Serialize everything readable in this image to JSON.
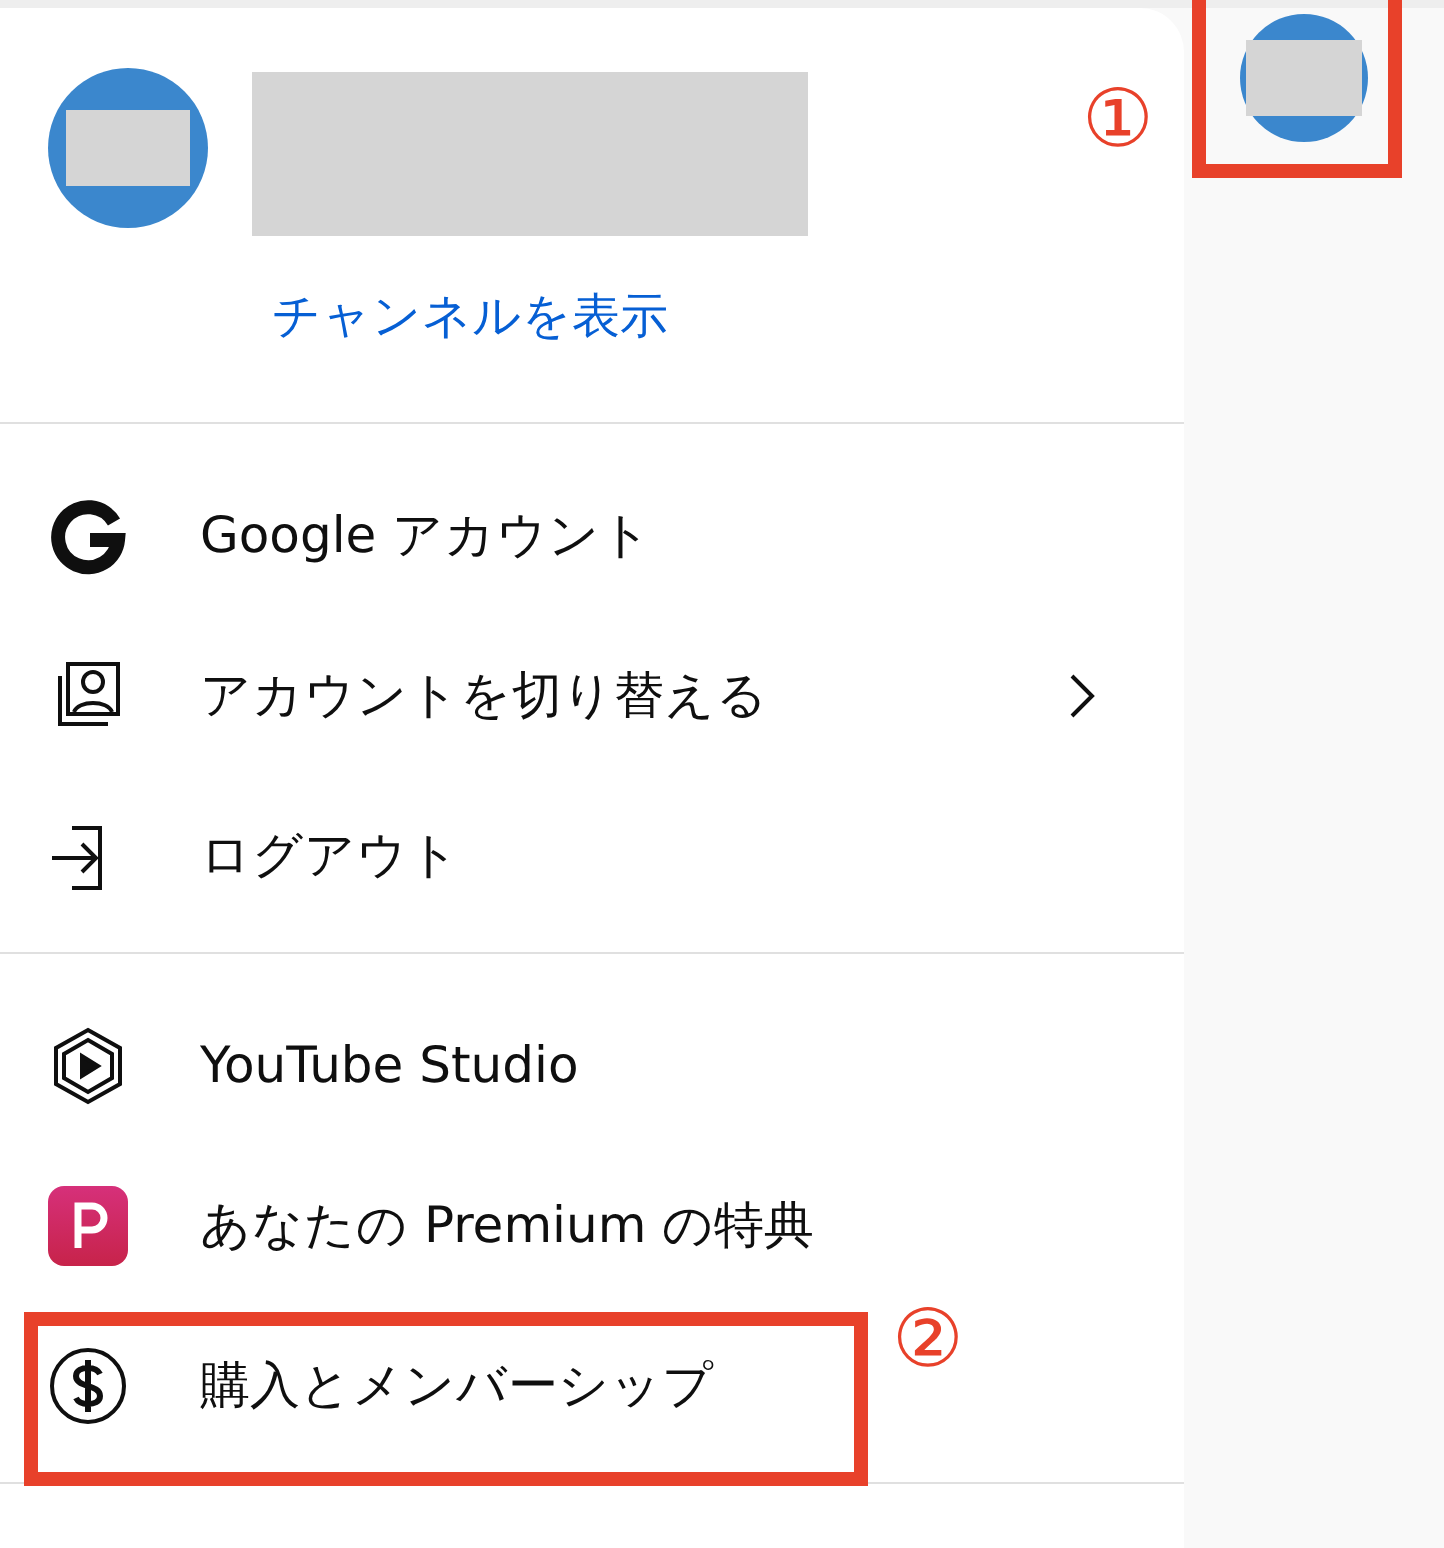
{
  "account_menu": {
    "channel_link": "チャンネルを表示",
    "sections": [
      {
        "items": [
          {
            "kind": "google",
            "label": "Google アカウント",
            "submenu": false
          },
          {
            "kind": "switch",
            "label": "アカウントを切り替える",
            "submenu": true
          },
          {
            "kind": "logout",
            "label": "ログアウト",
            "submenu": false
          }
        ]
      },
      {
        "items": [
          {
            "kind": "studio",
            "label": "YouTube Studio",
            "submenu": false
          },
          {
            "kind": "premium",
            "label": "あなたの Premium の特典",
            "submenu": false
          },
          {
            "kind": "purchases",
            "label": "購入とメンバーシップ",
            "submenu": false
          }
        ]
      }
    ]
  },
  "annotations": [
    {
      "label": "①"
    },
    {
      "label": "②"
    }
  ]
}
